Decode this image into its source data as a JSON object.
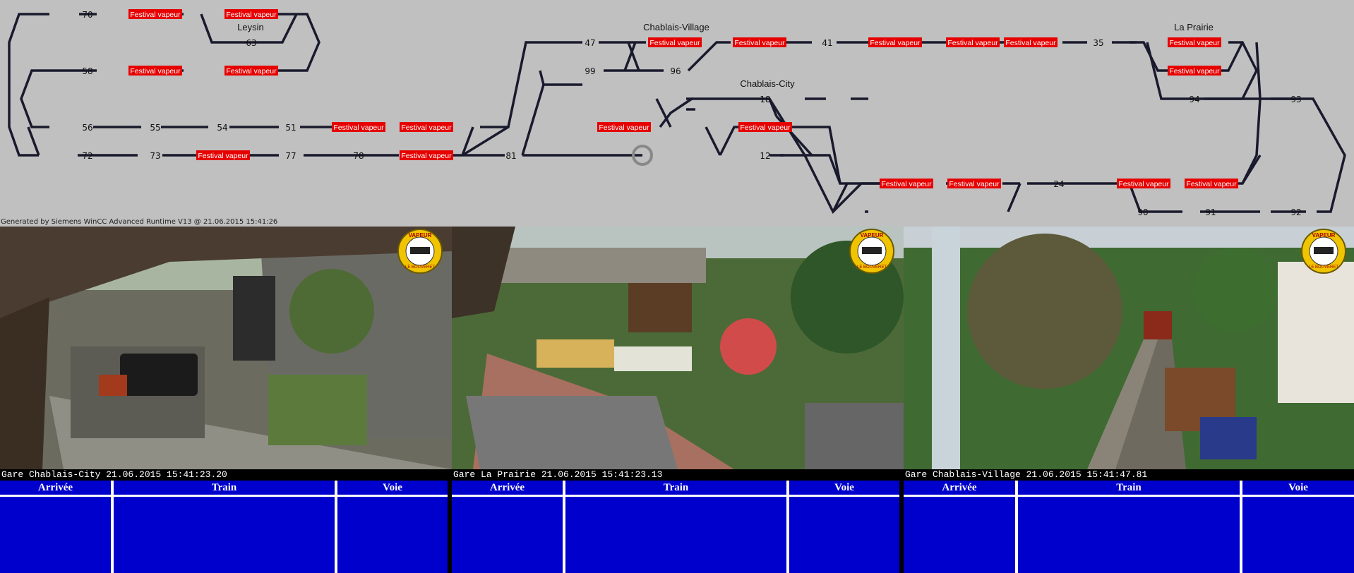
{
  "diagram": {
    "node_labels": [
      "70",
      "63",
      "58",
      "56",
      "55",
      "54",
      "51",
      "72",
      "73",
      "77",
      "78",
      "81",
      "47",
      "99",
      "96",
      "41",
      "35",
      "94",
      "93",
      "18",
      "12",
      "24",
      "90",
      "91",
      "92"
    ],
    "station_names": [
      "Leysin",
      "Chablais-Village",
      "Chablais-City",
      "La Prairie"
    ],
    "train_tag_text": "Festival vapeur",
    "footer_text": "Generated by Siemens WinCC Advanced Runtime V13 @ 21.06.2015 15:41:26"
  },
  "cameras": [
    {
      "caption": "Gare Chablais-City 21.06.2015 15:41:23.20",
      "columns": [
        "Arrivée",
        "Train",
        "Voie"
      ]
    },
    {
      "caption": "Gare La Prairie 21.06.2015 15:41:23.13",
      "columns": [
        "Arrivée",
        "Train",
        "Voie"
      ]
    },
    {
      "caption": "Gare Chablais-Village 21.06.2015 15:41:47.81",
      "columns": [
        "Arrivée",
        "Train",
        "Voie"
      ]
    }
  ],
  "logo_text": {
    "top": "VAPEUR",
    "middle": "SWISS PARC",
    "bottom": "LE BOUVERET"
  },
  "colors": {
    "track": "#1a1a2e",
    "tag_bg": "#e60000",
    "tag_text": "#ffffff",
    "board_bg": "#0000cc",
    "panel_bg": "#c0c0c0"
  }
}
